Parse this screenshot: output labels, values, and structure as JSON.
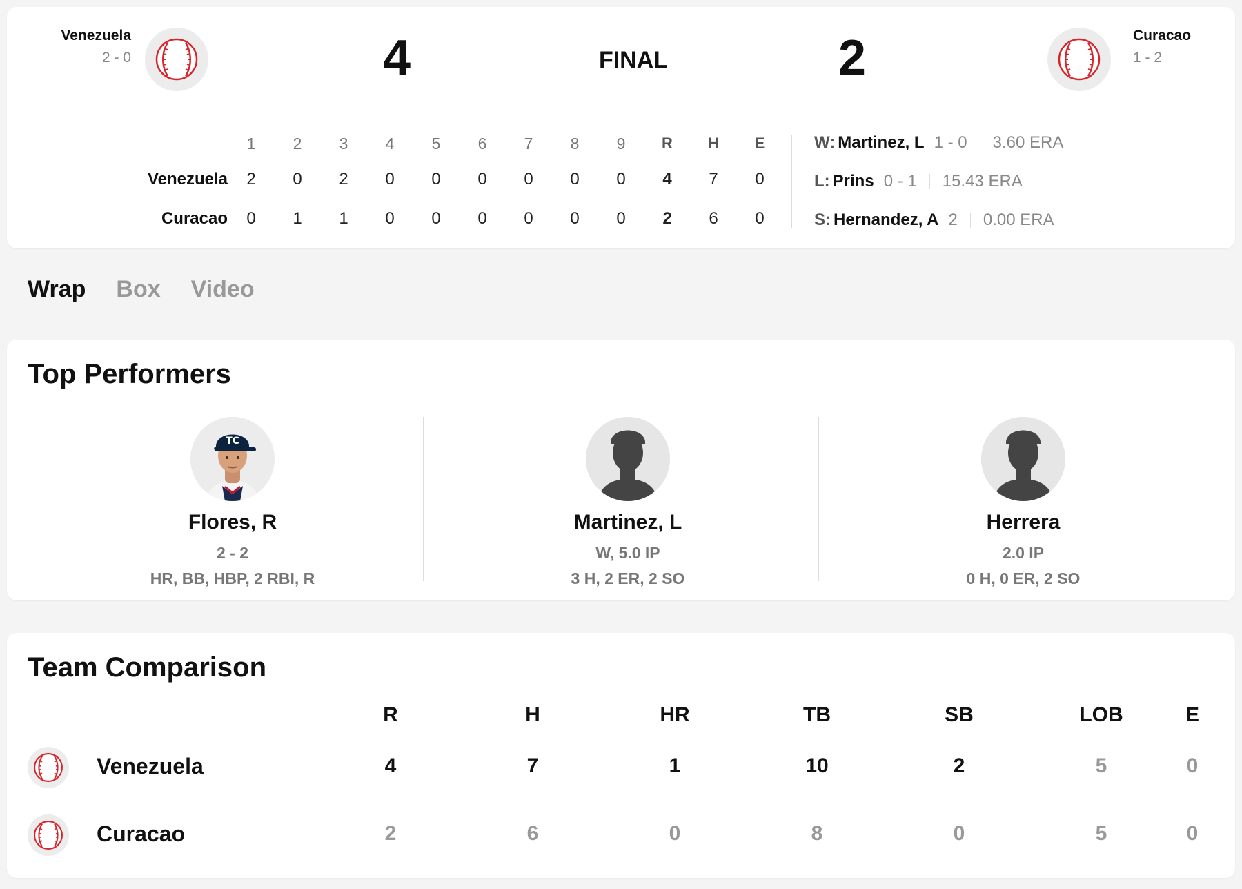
{
  "header": {
    "away": {
      "name": "Venezuela",
      "record": "2 - 0",
      "score": "4"
    },
    "home": {
      "name": "Curacao",
      "record": "1 - 2",
      "score": "2"
    },
    "status": "FINAL"
  },
  "linescore": {
    "headers": [
      "1",
      "2",
      "3",
      "4",
      "5",
      "6",
      "7",
      "8",
      "9",
      "R",
      "H",
      "E"
    ],
    "rows": [
      {
        "team": "Venezuela",
        "values": [
          "2",
          "0",
          "2",
          "0",
          "0",
          "0",
          "0",
          "0",
          "0",
          "4",
          "7",
          "0"
        ]
      },
      {
        "team": "Curacao",
        "values": [
          "0",
          "1",
          "1",
          "0",
          "0",
          "0",
          "0",
          "0",
          "0",
          "2",
          "6",
          "0"
        ]
      }
    ]
  },
  "pitchers": [
    {
      "label": "W:",
      "name": "Martinez, L",
      "record": "1 - 0",
      "stat": "3.60 ERA"
    },
    {
      "label": "L:",
      "name": "Prins",
      "record": "0 - 1",
      "stat": "15.43 ERA"
    },
    {
      "label": "S:",
      "name": "Hernandez, A",
      "record": "2",
      "stat": "0.00 ERA"
    }
  ],
  "tabs": [
    "Wrap",
    "Box",
    "Video"
  ],
  "active_tab": "Wrap",
  "top_performers": {
    "title": "Top Performers",
    "players": [
      {
        "name": "Flores, R",
        "line1": "2 - 2",
        "line2": "HR, BB, HBP, 2 RBI, R",
        "photo": "player-photo"
      },
      {
        "name": "Martinez, L",
        "line1": "W, 5.0 IP",
        "line2": "3 H, 2 ER, 2 SO",
        "photo": "silhouette"
      },
      {
        "name": "Herrera",
        "line1": "2.0 IP",
        "line2": "0 H, 0 ER, 2 SO",
        "photo": "silhouette"
      }
    ]
  },
  "team_comparison": {
    "title": "Team Comparison",
    "columns": [
      "R",
      "H",
      "HR",
      "TB",
      "SB",
      "LOB",
      "E"
    ],
    "rows": [
      {
        "team": "Venezuela",
        "values": [
          "4",
          "7",
          "1",
          "10",
          "2",
          "5",
          "0"
        ],
        "leader": [
          true,
          true,
          true,
          true,
          true,
          false,
          false
        ]
      },
      {
        "team": "Curacao",
        "values": [
          "2",
          "6",
          "0",
          "8",
          "0",
          "5",
          "0"
        ],
        "leader": [
          false,
          false,
          false,
          false,
          false,
          false,
          false
        ]
      }
    ]
  },
  "colors": {
    "accent_red": "#d6262b",
    "background": "#f4f4f4",
    "card": "#ffffff",
    "muted": "#999999"
  },
  "icons": {
    "team_logo": "baseball-icon"
  }
}
